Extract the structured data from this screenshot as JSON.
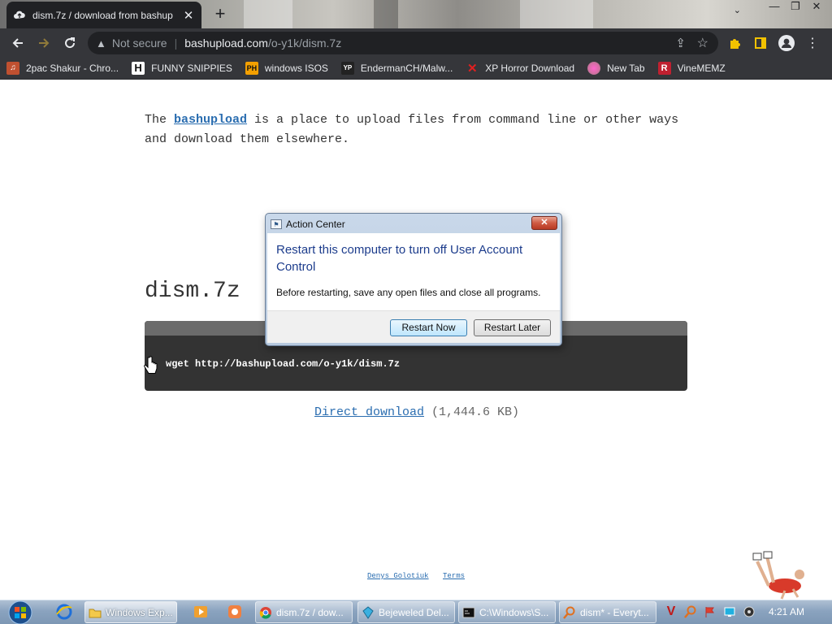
{
  "browser": {
    "tab": {
      "title": "dism.7z / download from bashup",
      "close": "✕"
    },
    "new_tab": "+",
    "window_controls": [
      "—",
      "❐",
      "✕"
    ],
    "omnibox": {
      "security": "Not secure",
      "host": "bashupload.com",
      "path": "/o-y1k/dism.7z"
    },
    "bookmarks": [
      {
        "label": "2pac Shakur - Chro...",
        "icon": "music-icon",
        "color": "#c05030"
      },
      {
        "label": "FUNNY SNIPPIES",
        "icon": "H",
        "color": "#ffffff"
      },
      {
        "label": "windows ISOS",
        "icon": "PH",
        "color": "#f4a000"
      },
      {
        "label": "EndermanCH/Malw...",
        "icon": "YP",
        "color": "#222222"
      },
      {
        "label": "XP Horror Download",
        "icon": "X",
        "color": "#e02020"
      },
      {
        "label": "New Tab",
        "icon": "globe-icon",
        "color": "#d070a0"
      },
      {
        "label": "VineMEMZ",
        "icon": "R",
        "color": "#c02030"
      }
    ]
  },
  "page": {
    "intro_before": "The ",
    "intro_link": "bashupload",
    "intro_after": " is a place to upload files from command line or other ways and download them elsewhere.",
    "filename": "dism.7z",
    "command": "wget http://bashupload.com/o-y1k/dism.7z",
    "direct_download": "Direct download",
    "file_size": " (1,444.6 KB)",
    "footer_author": "Denys Golotiuk",
    "footer_terms": "Terms"
  },
  "dialog": {
    "title": "Action Center",
    "close": "✕",
    "heading": "Restart this computer to turn off User Account Control",
    "message": "Before restarting, save any open files and close all programs.",
    "primary_button": "Restart Now",
    "secondary_button": "Restart Later"
  },
  "taskbar": {
    "tasks": [
      {
        "label": "Windows Exp...",
        "icon": "folder-icon"
      },
      {
        "label": "dism.7z / dow...",
        "icon": "chrome-icon"
      },
      {
        "label": "Bejeweled Del...",
        "icon": "gem-icon"
      },
      {
        "label": "C:\\Windows\\S...",
        "icon": "cmd-icon"
      },
      {
        "label": "dism* - Everyt...",
        "icon": "search-icon"
      }
    ],
    "clock": "4:21 AM"
  }
}
